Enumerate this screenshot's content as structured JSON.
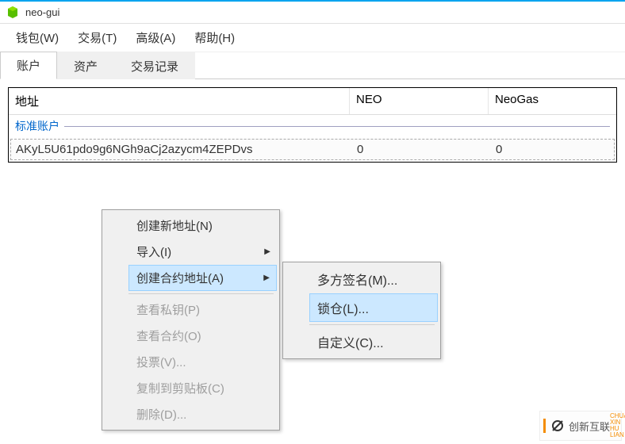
{
  "window": {
    "title": "neo-gui"
  },
  "menubar": {
    "wallet": "钱包(W)",
    "transaction": "交易(T)",
    "advanced": "高级(A)",
    "help": "帮助(H)"
  },
  "tabs": {
    "account": "账户",
    "asset": "资产",
    "tx_record": "交易记录"
  },
  "table": {
    "headers": {
      "address": "地址",
      "neo": "NEO",
      "neogas": "NeoGas"
    },
    "group_label": "标准账户",
    "rows": [
      {
        "address": "AKyL5U61pdo9g6NGh9aCj2azycm4ZEPDvs",
        "neo": "0",
        "neogas": "0"
      }
    ]
  },
  "context_menu": {
    "create_address": "创建新地址(N)",
    "import": "导入(I)",
    "create_contract_address": "创建合约地址(A)",
    "view_private_key": "查看私钥(P)",
    "view_contract": "查看合约(O)",
    "vote": "投票(V)...",
    "copy_to_clipboard": "复制到剪贴板(C)",
    "delete": "删除(D)..."
  },
  "submenu": {
    "multisig": "多方签名(M)...",
    "lock": "锁仓(L)...",
    "custom": "自定义(C)..."
  },
  "watermark": {
    "text": "创新互联",
    "side": "CHUANG XIN HU LIAN"
  }
}
